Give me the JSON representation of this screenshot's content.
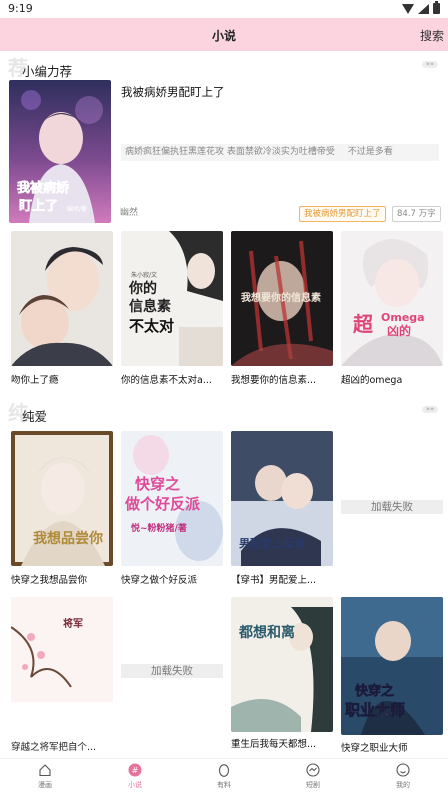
{
  "status_bar": {
    "time": "9:19"
  },
  "header": {
    "title": "小说",
    "search_label": "搜索"
  },
  "section1": {
    "watermark": "荐",
    "label": "小编力荐",
    "more": "»»",
    "featured": {
      "title": "我被病娇男配盯上了",
      "description": "病娇疯狂偏执狂黑莲花攻 表面禁欲冷淡实为吐槽帝受",
      "description_tail": "不过是多看",
      "author": "幽然",
      "tag": "我被病娇男配盯上了",
      "word_count": "84.7 万字",
      "cover_title": "我被病娇",
      "cover_title2": "盯上了",
      "cover_sub": "幽然/著"
    },
    "books": [
      {
        "name": "吻你上了瘾"
      },
      {
        "name": "你的信息素不太对a...",
        "cover_line1": "你的",
        "cover_line2": "信息素",
        "cover_line3": "不太对",
        "cover_author": "朱小寂/文"
      },
      {
        "name": "我想要你的信息素...",
        "cover_text": "我想要你的信息素"
      },
      {
        "name": "超凶的omega",
        "cover_line1": "超",
        "cover_line2": "Omega",
        "cover_line3": "凶的"
      }
    ]
  },
  "section2": {
    "watermark": "纯",
    "label": "纯爱",
    "more": "»»",
    "row1": [
      {
        "name": "快穿之我想品尝你",
        "cover_text": "我想品尝你"
      },
      {
        "name": "快穿之做个好反派",
        "cover_line1": "快穿之",
        "cover_line2": "做个好反派",
        "cover_author": "悦~粉粉猪/著"
      },
      {
        "name": "【穿书】男配爱上...",
        "cover_text": "男配爱上反派"
      },
      {
        "name": "",
        "load_failed": "加载失败"
      }
    ],
    "row2": [
      {
        "name": "穿越之将军把自个...",
        "cover_text": "将军"
      },
      {
        "name": "",
        "load_failed": "加载失败"
      },
      {
        "name": "重生后我每天都想...",
        "cover_text": "都想和离"
      },
      {
        "name": "快穿之职业大师",
        "cover_line1": "快穿之",
        "cover_line2": "职业大师"
      }
    ]
  },
  "bottom_nav": [
    {
      "label": "漫画",
      "icon": "home-icon"
    },
    {
      "label": "小说",
      "icon": "novel-icon",
      "active": true
    },
    {
      "label": "有料",
      "icon": "egg-icon"
    },
    {
      "label": "短剧",
      "icon": "video-icon"
    },
    {
      "label": "我的",
      "icon": "profile-icon"
    }
  ],
  "colors": {
    "accent": "#fbd4e0",
    "active_nav": "#e8739a",
    "tag_border": "#f4b35e"
  }
}
